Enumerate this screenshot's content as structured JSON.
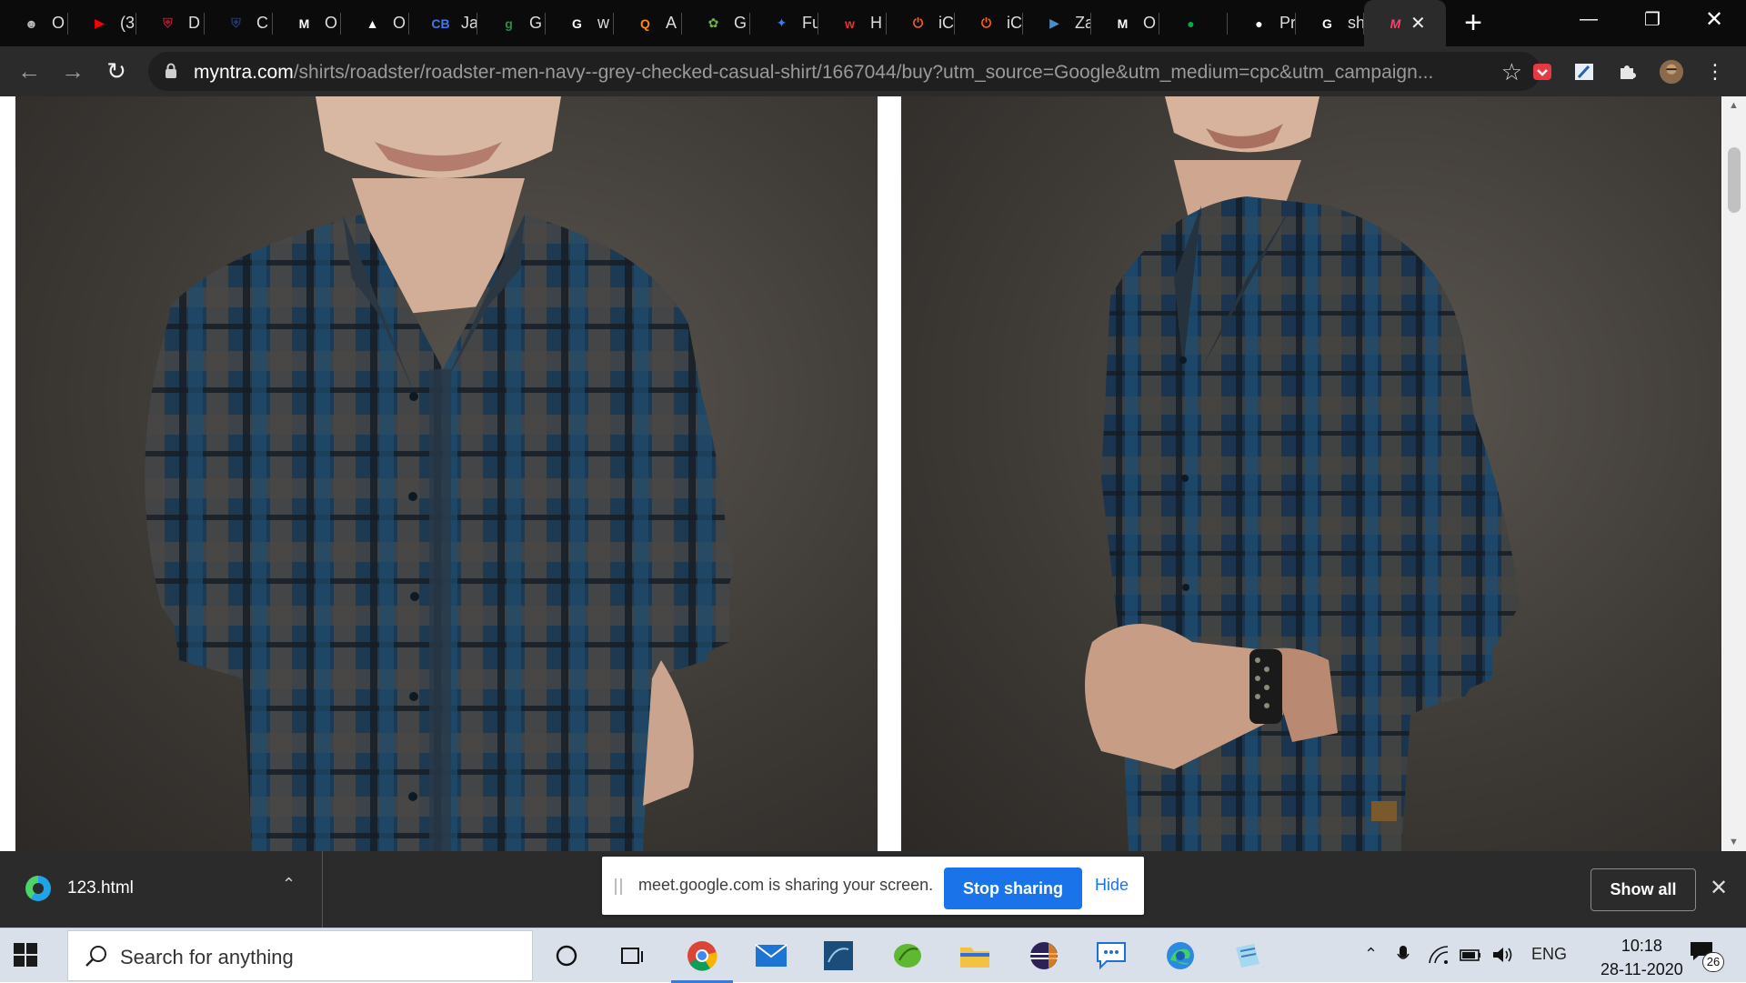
{
  "browser": {
    "tabs": [
      {
        "title": "O",
        "icon": "avatar-icon",
        "color": "#b8b8b8"
      },
      {
        "title": "(3",
        "icon": "youtube-icon",
        "color": "#ff0000"
      },
      {
        "title": "D",
        "icon": "harvard-shield-icon",
        "color": "#a51c30"
      },
      {
        "title": "C",
        "icon": "shield-icon",
        "color": "#1f3b6e"
      },
      {
        "title": "O",
        "icon": "gmail-icon",
        "color": "#ffffff"
      },
      {
        "title": "O",
        "icon": "google-drive-icon",
        "color": "#ffffff"
      },
      {
        "title": "Ja",
        "icon": "cb-icon",
        "color": "#3c7be8"
      },
      {
        "title": "G",
        "icon": "gfg-icon",
        "color": "#2f8d46"
      },
      {
        "title": "w",
        "icon": "google-icon",
        "color": "#ffffff"
      },
      {
        "title": "A",
        "icon": "search-q-icon",
        "color": "#ff8a00"
      },
      {
        "title": "G",
        "icon": "spring-icon",
        "color": "#6db33f"
      },
      {
        "title": "Fu",
        "icon": "feather-icon",
        "color": "#3c7be8"
      },
      {
        "title": "H",
        "icon": "w-logo-icon",
        "color": "#e8322b"
      },
      {
        "title": "iC",
        "icon": "power-icon",
        "color": "#ff5a1f"
      },
      {
        "title": "iC",
        "icon": "power-icon",
        "color": "#ff5a1f"
      },
      {
        "title": "Za",
        "icon": "play-box-icon",
        "color": "#4b8fc7"
      },
      {
        "title": "O",
        "icon": "gmail-icon",
        "color": "#ffffff"
      },
      {
        "title": "",
        "icon": "meet-icon",
        "color": "#00ac47"
      },
      {
        "title": "Pr",
        "icon": "globe-icon",
        "color": "#ffffff"
      },
      {
        "title": "sh",
        "icon": "google-icon",
        "color": "#ffffff"
      }
    ],
    "active_tab": {
      "title": "",
      "icon": "myntra-icon",
      "color": "#ff3f6c"
    },
    "url_host": "myntra.com",
    "url_path": "/shirts/roadster/roadster-men-navy--grey-checked-casual-shirt/1667044/buy?utm_source=Google&utm_medium=cpc&utm_campaign..."
  },
  "downloads": {
    "file_name": "123.html",
    "share_message": "meet.google.com is sharing your screen.",
    "stop_sharing_label": "Stop sharing",
    "hide_label": "Hide",
    "show_all_label": "Show all"
  },
  "taskbar": {
    "search_placeholder": "Search for anything",
    "apps": [
      "chrome-icon",
      "mail-icon",
      "mysql-workbench-icon",
      "spring-tool-icon",
      "file-explorer-icon",
      "eclipse-icon",
      "feedback-icon",
      "edge-icon",
      "notepad-icon"
    ],
    "language": "ENG",
    "time": "10:18",
    "date": "28-11-2020",
    "notification_count": "26"
  }
}
